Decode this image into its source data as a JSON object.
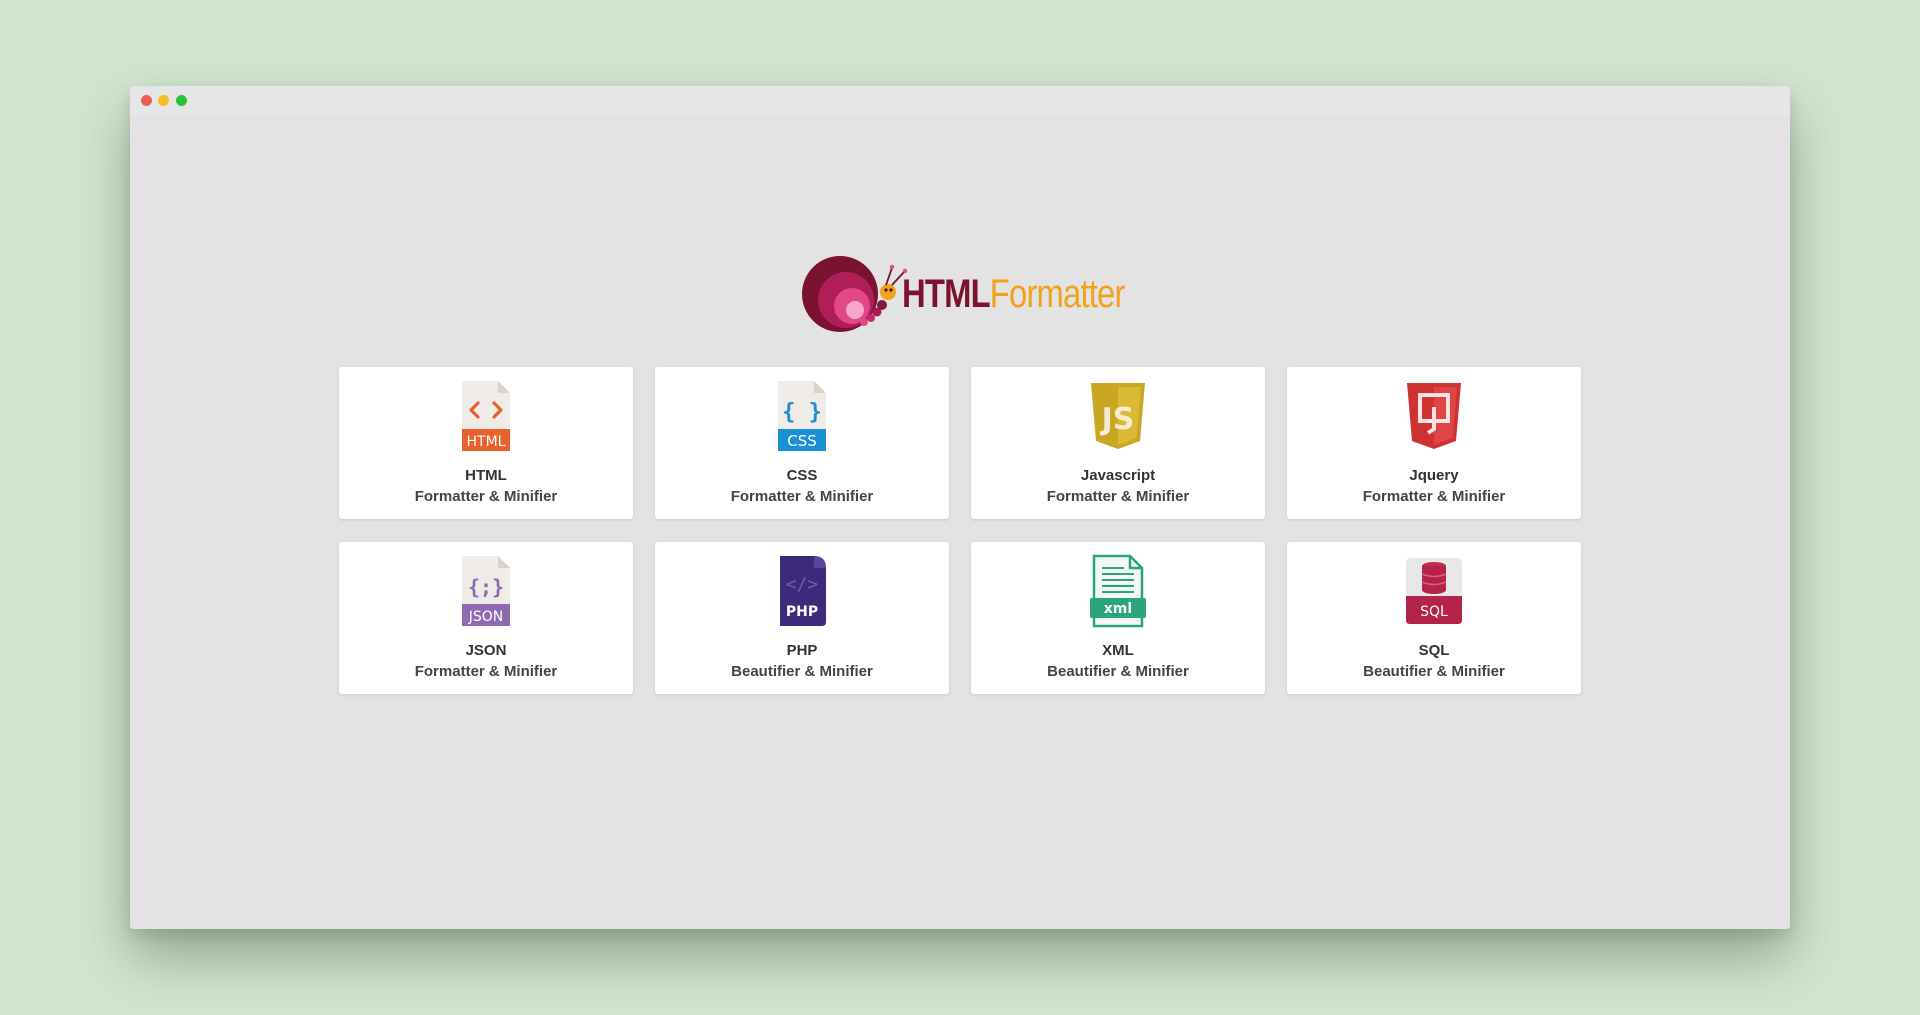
{
  "window": {
    "controls": [
      "close",
      "minimize",
      "maximize"
    ]
  },
  "logo": {
    "part1": "HTML",
    "part2": "Formatter",
    "icon": "snail-logo-icon"
  },
  "colors": {
    "background": "#d3e5d0",
    "window": "#e3e3e3",
    "card": "#ffffff",
    "logo_primary": "#7a1230",
    "logo_accent": "#f0a21a"
  },
  "cards": [
    {
      "title": "HTML",
      "subtitle": "Formatter & Minifier",
      "icon": "html-file-icon",
      "color": "#e8612c"
    },
    {
      "title": "CSS",
      "subtitle": "Formatter & Minifier",
      "icon": "css-file-icon",
      "color": "#1a8fd6"
    },
    {
      "title": "Javascript",
      "subtitle": "Formatter & Minifier",
      "icon": "js-shield-icon",
      "color": "#d4b32a"
    },
    {
      "title": "Jquery",
      "subtitle": "Formatter & Minifier",
      "icon": "jquery-shield-icon",
      "color": "#d83a3a"
    },
    {
      "title": "JSON",
      "subtitle": "Formatter & Minifier",
      "icon": "json-file-icon",
      "color": "#8e6bb0"
    },
    {
      "title": "PHP",
      "subtitle": "Beautifier & Minifier",
      "icon": "php-file-icon",
      "color": "#3d2a7a"
    },
    {
      "title": "XML",
      "subtitle": "Beautifier & Minifier",
      "icon": "xml-file-icon",
      "color": "#2aa57e"
    },
    {
      "title": "SQL",
      "subtitle": "Beautifier & Minifier",
      "icon": "sql-database-icon",
      "color": "#b3234a"
    }
  ],
  "icon_labels": {
    "html": "HTML",
    "css": "CSS",
    "json": "JSON",
    "php": "PHP",
    "xml": "xml",
    "sql": "SQL",
    "js": "JS"
  }
}
